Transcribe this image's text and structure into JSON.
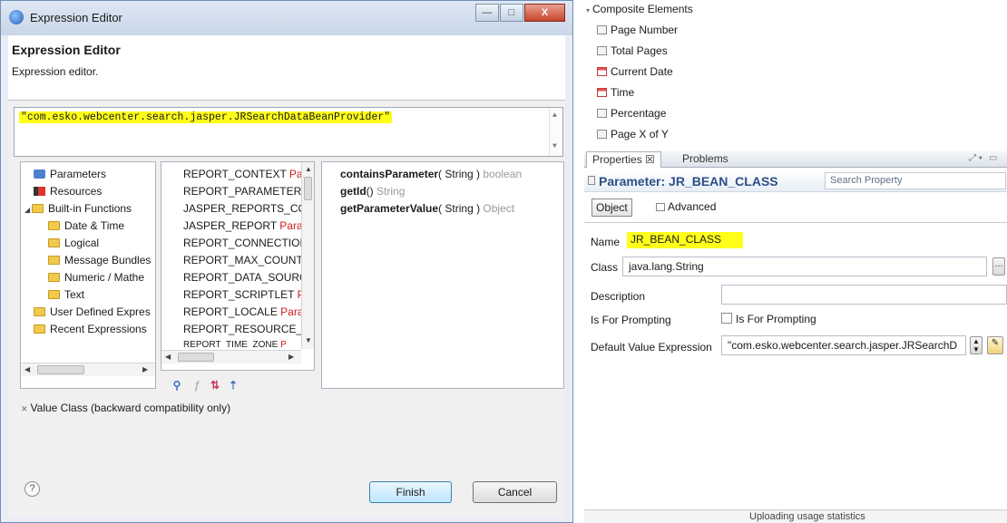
{
  "dialog": {
    "window_title": "Expression Editor",
    "header_title": "Expression Editor",
    "header_subtitle": "Expression editor.",
    "expression": "\"com.esko.webcenter.search.jasper.JRSearchDataBeanProvider\"",
    "window_buttons": {
      "minimize": "—",
      "maximize": "□",
      "close": "X"
    },
    "categories": [
      {
        "label": "Parameters",
        "icon": "parameters-icon"
      },
      {
        "label": "Resources",
        "icon": "resources-icon"
      },
      {
        "label": "Built-in Functions",
        "icon": "folder-icon"
      },
      {
        "label": "Date & Time",
        "icon": "folder-icon"
      },
      {
        "label": "Logical",
        "icon": "folder-icon"
      },
      {
        "label": "Message Bundles",
        "icon": "folder-icon"
      },
      {
        "label": "Numeric / Mathe",
        "icon": "folder-icon"
      },
      {
        "label": "Text",
        "icon": "folder-icon"
      },
      {
        "label": "User Defined Expres",
        "icon": "folder-icon"
      },
      {
        "label": "Recent Expressions",
        "icon": "folder-icon"
      }
    ],
    "parameters": [
      {
        "name": "REPORT_CONTEXT",
        "type": "Para"
      },
      {
        "name": "REPORT_PARAMETERS_",
        "type": ""
      },
      {
        "name": "JASPER_REPORTS_CON",
        "type": ""
      },
      {
        "name": "JASPER_REPORT",
        "type": "Param"
      },
      {
        "name": "REPORT_CONNECTION",
        "type": ""
      },
      {
        "name": "REPORT_MAX_COUNT",
        "type": "I"
      },
      {
        "name": "REPORT_DATA_SOURC",
        "type": ""
      },
      {
        "name": "REPORT_SCRIPTLET",
        "type": "Par"
      },
      {
        "name": "REPORT_LOCALE",
        "type": "Param"
      },
      {
        "name": "REPORT_RESOURCE_BU",
        "type": ""
      },
      {
        "name": "REPORT_TIME_ZONE",
        "type": "P"
      }
    ],
    "methods": [
      {
        "name": "containsParameter",
        "args": "( String )",
        "returns": "boolean"
      },
      {
        "name": "getId",
        "args": "()",
        "returns": "String"
      },
      {
        "name": "getParameterValue",
        "args": "( String )",
        "returns": "Object"
      }
    ],
    "value_class_label": "Value Class (backward compatibility only)",
    "finish_label": "Finish",
    "cancel_label": "Cancel",
    "help_label": "?"
  },
  "composite": {
    "header": "Composite Elements",
    "items": [
      {
        "label": "Page Number",
        "icon": "page-number-icon"
      },
      {
        "label": "Total Pages",
        "icon": "total-pages-icon"
      },
      {
        "label": "Current Date",
        "icon": "calendar-icon"
      },
      {
        "label": "Time",
        "icon": "calendar-icon"
      },
      {
        "label": "Percentage",
        "icon": "percentage-icon"
      },
      {
        "label": "Page X of Y",
        "icon": "page-x-of-y-icon"
      }
    ]
  },
  "properties": {
    "tabs": [
      {
        "label": "Properties ☒"
      },
      {
        "label": "Problems"
      }
    ],
    "title": "Parameter: JR_BEAN_CLASS",
    "search_placeholder": "Search Property",
    "subtabs": [
      "Object",
      "Advanced"
    ],
    "fields": {
      "name_label": "Name",
      "name_value": "JR_BEAN_CLASS",
      "class_label": "Class",
      "class_value": "java.lang.String",
      "description_label": "Description",
      "description_value": "",
      "prompting_label": "Is For Prompting",
      "prompting_checkbox_label": "Is For Prompting",
      "default_label": "Default Value Expression",
      "default_value": "\"com.esko.webcenter.search.jasper.JRSearchD"
    },
    "status": "Uploading usage statistics"
  }
}
